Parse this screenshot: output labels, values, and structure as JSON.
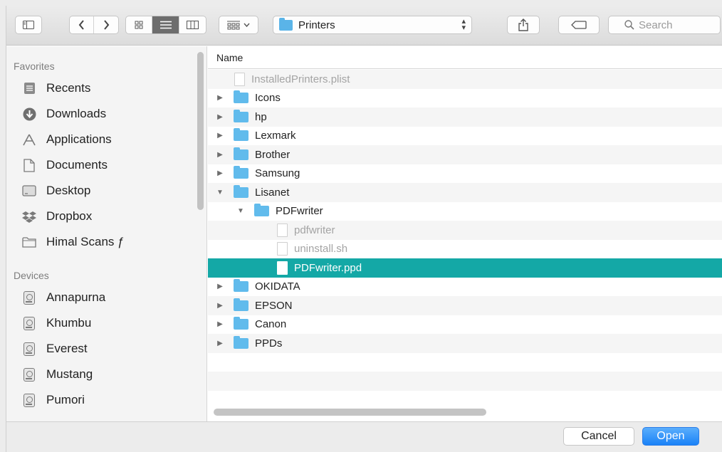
{
  "toolbar": {
    "location": "Printers",
    "search_placeholder": "Search"
  },
  "sidebar": {
    "favorites_title": "Favorites",
    "favorites": [
      {
        "label": "Recents",
        "icon": "recents-icon"
      },
      {
        "label": "Downloads",
        "icon": "downloads-icon"
      },
      {
        "label": "Applications",
        "icon": "applications-icon"
      },
      {
        "label": "Documents",
        "icon": "documents-icon"
      },
      {
        "label": "Desktop",
        "icon": "desktop-icon"
      },
      {
        "label": "Dropbox",
        "icon": "dropbox-icon"
      },
      {
        "label": "Himal Scans ƒ",
        "icon": "folder-icon"
      }
    ],
    "devices_title": "Devices",
    "devices": [
      {
        "label": "Annapurna",
        "icon": "disk-icon"
      },
      {
        "label": "Khumbu",
        "icon": "disk-icon"
      },
      {
        "label": "Everest",
        "icon": "disk-icon"
      },
      {
        "label": "Mustang",
        "icon": "disk-icon"
      },
      {
        "label": "Pumori",
        "icon": "disk-icon"
      }
    ]
  },
  "list": {
    "column_name": "Name",
    "rows": [
      {
        "name": "InstalledPrinters.plist",
        "kind": "file"
      },
      {
        "name": "Icons",
        "kind": "folder"
      },
      {
        "name": "hp",
        "kind": "folder"
      },
      {
        "name": "Lexmark",
        "kind": "folder"
      },
      {
        "name": "Brother",
        "kind": "folder"
      },
      {
        "name": "Samsung",
        "kind": "folder"
      },
      {
        "name": "Lisanet",
        "kind": "folder",
        "expanded": true
      },
      {
        "name": "PDFwriter",
        "kind": "folder",
        "expanded": true
      },
      {
        "name": "pdfwriter",
        "kind": "file"
      },
      {
        "name": "uninstall.sh",
        "kind": "file"
      },
      {
        "name": "PDFwriter.ppd",
        "kind": "file",
        "selected": true
      },
      {
        "name": "OKIDATA",
        "kind": "folder"
      },
      {
        "name": "EPSON",
        "kind": "folder"
      },
      {
        "name": "Canon",
        "kind": "folder"
      },
      {
        "name": "PPDs",
        "kind": "folder"
      }
    ]
  },
  "footer": {
    "cancel_label": "Cancel",
    "open_label": "Open"
  },
  "colors": {
    "selection": "#14a8a6",
    "folder": "#61bbec",
    "primary_button": "#1a82f7"
  }
}
